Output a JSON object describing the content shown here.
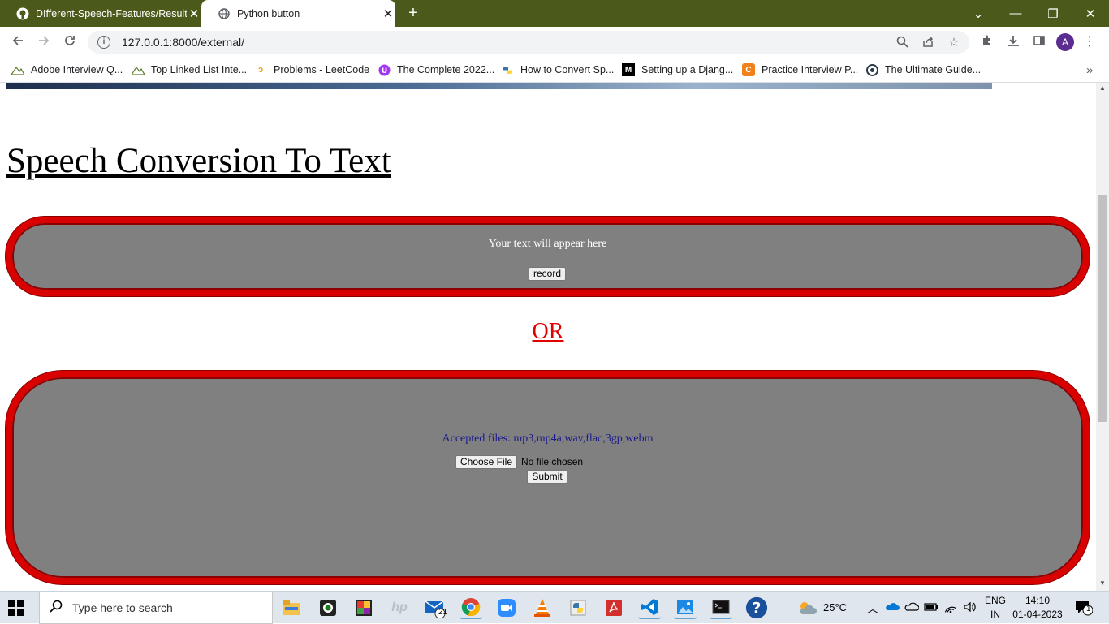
{
  "browser": {
    "tabs": [
      {
        "title": "DIfferent-Speech-Features/Result",
        "close": "✕"
      },
      {
        "title": "Python button",
        "close": "✕"
      }
    ],
    "new_tab": "+",
    "window_controls": {
      "chevron": "⌄",
      "minimize": "—",
      "restore": "❐",
      "close": "✕"
    },
    "url": "127.0.0.1:8000/external/",
    "bookmarks": [
      "Adobe Interview Q...",
      "Top Linked List Inte...",
      "Problems - LeetCode",
      "The Complete 2022...",
      "How to Convert Sp...",
      "Setting up a Djang...",
      "Practice Interview P...",
      "The Ultimate Guide..."
    ],
    "bookmarks_more": "»",
    "profile_initial": "A"
  },
  "page": {
    "heading": "Speech Conversion To Text",
    "record_section": {
      "placeholder": "Your text will appear here",
      "record_button": "record"
    },
    "or_text": "OR",
    "upload_section": {
      "accepted": "Accepted files: mp3,mp4a,wav,flac,3gp,webm",
      "choose_file": "Choose File",
      "no_file": "No file chosen",
      "submit": "Submit"
    }
  },
  "taskbar": {
    "search_placeholder": "Type here to search",
    "mail_badge": "21",
    "weather": "25°C",
    "language": "ENG",
    "region": "IN",
    "time": "14:10",
    "date": "01-04-2023",
    "notification_count": "1"
  },
  "colors": {
    "chrome_frame": "#4b5a1b",
    "box_border": "#d90000",
    "box_fill": "#808080",
    "or_text": "#e00000",
    "accepted_text": "#1a1a8c"
  }
}
